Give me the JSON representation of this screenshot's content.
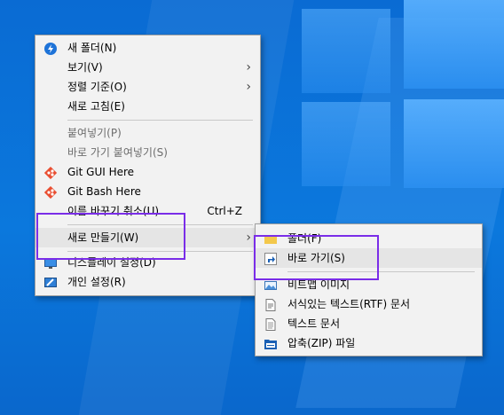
{
  "context_menu": {
    "items": [
      {
        "label": "새 폴더(N)",
        "icon": "new-folder-icon"
      },
      {
        "label": "보기(V)",
        "submenu": true
      },
      {
        "label": "정렬 기준(O)",
        "submenu": true
      },
      {
        "label": "새로 고침(E)"
      },
      {
        "label": "붙여넣기(P)",
        "disabled": true
      },
      {
        "label": "바로 가기 붙여넣기(S)",
        "disabled": true
      },
      {
        "label": "Git GUI Here",
        "icon": "git-icon"
      },
      {
        "label": "Git Bash Here",
        "icon": "git-icon"
      },
      {
        "label": "이름 바꾸기 취소(U)",
        "shortcut": "Ctrl+Z"
      },
      {
        "label": "새로 만들기(W)",
        "submenu": true
      },
      {
        "label": "디스플레이 설정(D)",
        "icon": "display-settings-icon"
      },
      {
        "label": "개인 설정(R)",
        "icon": "personalize-icon"
      }
    ]
  },
  "submenu_new": {
    "items": [
      {
        "label": "폴더(F)",
        "icon": "folder-icon"
      },
      {
        "label": "바로 가기(S)",
        "icon": "shortcut-icon"
      },
      {
        "label": "비트맵 이미지",
        "icon": "bitmap-icon"
      },
      {
        "label": "서식있는 텍스트(RTF) 문서",
        "icon": "rtf-document-icon"
      },
      {
        "label": "텍스트 문서",
        "icon": "text-document-icon"
      },
      {
        "label": "압축(ZIP) 파일",
        "icon": "zip-folder-icon"
      }
    ]
  },
  "colors": {
    "annotation": "#7a2de8",
    "menu_bg": "#f2f2f2",
    "desktop": "#0b78dd"
  }
}
